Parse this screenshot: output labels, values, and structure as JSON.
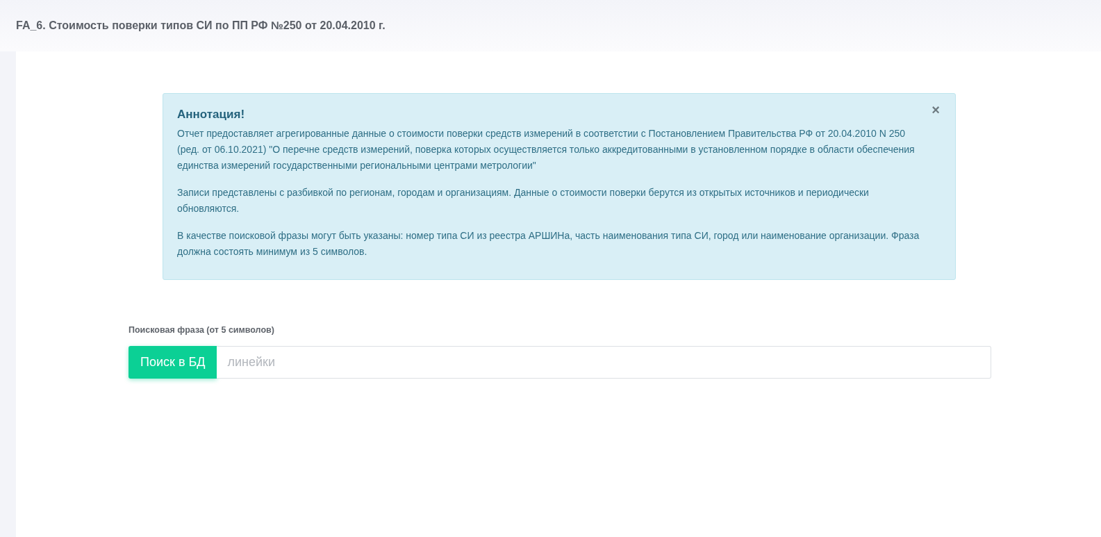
{
  "page": {
    "title": "FA_6. Стоимость поверки типов СИ по ПП РФ №250 от 20.04.2010 г."
  },
  "alert": {
    "heading": "Аннотация!",
    "close": "×",
    "paragraphs": [
      "Отчет предоставляет агрегированные данные о стоимости поверки средств измерений в соответстии с Постановлением Правительства РФ от 20.04.2010 N 250 (ред. от 06.10.2021) \"О перечне средств измерений, поверка которых осуществляется только аккредитованными в установленном порядке в области обеспечения единства измерений государственными региональными центрами метрологии\"",
      "Записи представлены с разбивкой по регионам, городам и организациям. Данные о стоимости поверки берутся из открытых источников и периодически обновляются.",
      "В качестве поисковой фразы могут быть указаны: номер типа СИ из реестра АРШИНа, часть наименования типа СИ, город или наименование организации. Фраза должна состоять минимум из 5 символов."
    ]
  },
  "search": {
    "label": "Поисковая фраза (от 5 символов)",
    "button": "Поиск в БД",
    "placeholder": "линейки"
  }
}
